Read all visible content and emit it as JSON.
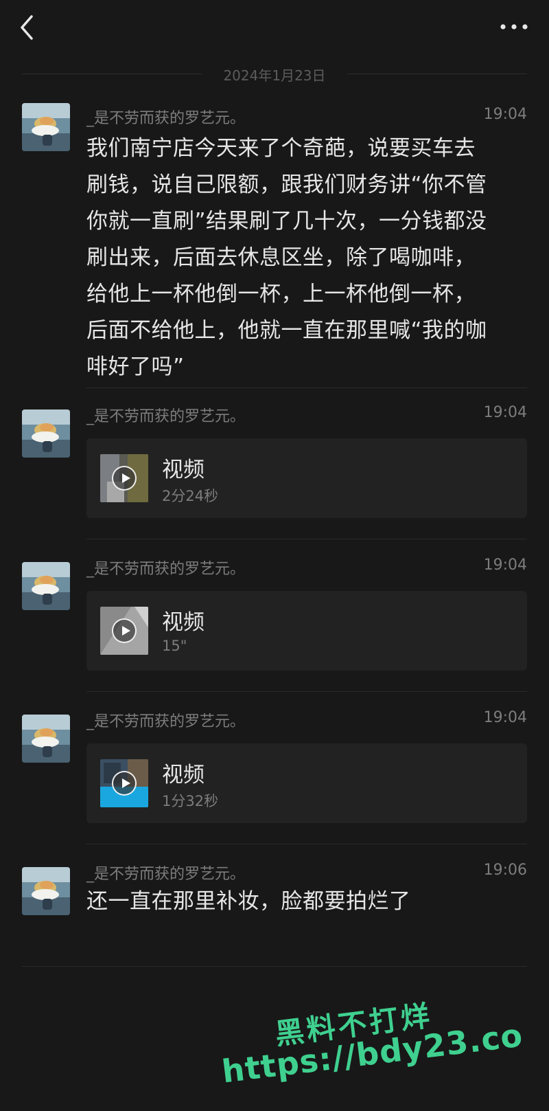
{
  "header": {
    "back_icon": "chevron-left-icon",
    "more_icon": "more-dots-icon"
  },
  "date_divider": "2024年1月23日",
  "messages": [
    {
      "sender": "_是不劳而获的罗艺元。",
      "time": "19:04",
      "type": "text",
      "lines": [
        "我们南宁店今天来了个奇葩，说要买车去",
        "刷钱，说自己限额，跟我们财务讲“你不管",
        "你就一直刷”结果刷了几十次，一分钱都没",
        "刷出来，后面去休息区坐，除了喝咖啡，",
        "给他上一杯他倒一杯，上一杯他倒一杯，",
        "后面不给他上，他就一直在那里喊“我的咖",
        "啡好了吗”"
      ]
    },
    {
      "sender": "_是不劳而获的罗艺元。",
      "time": "19:04",
      "type": "video",
      "title": "视频",
      "duration": "2分24秒"
    },
    {
      "sender": "_是不劳而获的罗艺元。",
      "time": "19:04",
      "type": "video",
      "title": "视频",
      "duration": "15\""
    },
    {
      "sender": "_是不劳而获的罗艺元。",
      "time": "19:04",
      "type": "video",
      "title": "视频",
      "duration": "1分32秒"
    },
    {
      "sender": "_是不劳而获的罗艺元。",
      "time": "19:06",
      "type": "text",
      "lines": [
        "还一直在那里补妆，脸都要拍烂了"
      ]
    }
  ],
  "watermark": {
    "line1": "黑料不打烊",
    "line2": "https://bdy23.co"
  },
  "colors": {
    "background": "#181818",
    "text": "#e6e6e6",
    "meta": "#7d7d7d",
    "watermark": "#3fd08f"
  }
}
